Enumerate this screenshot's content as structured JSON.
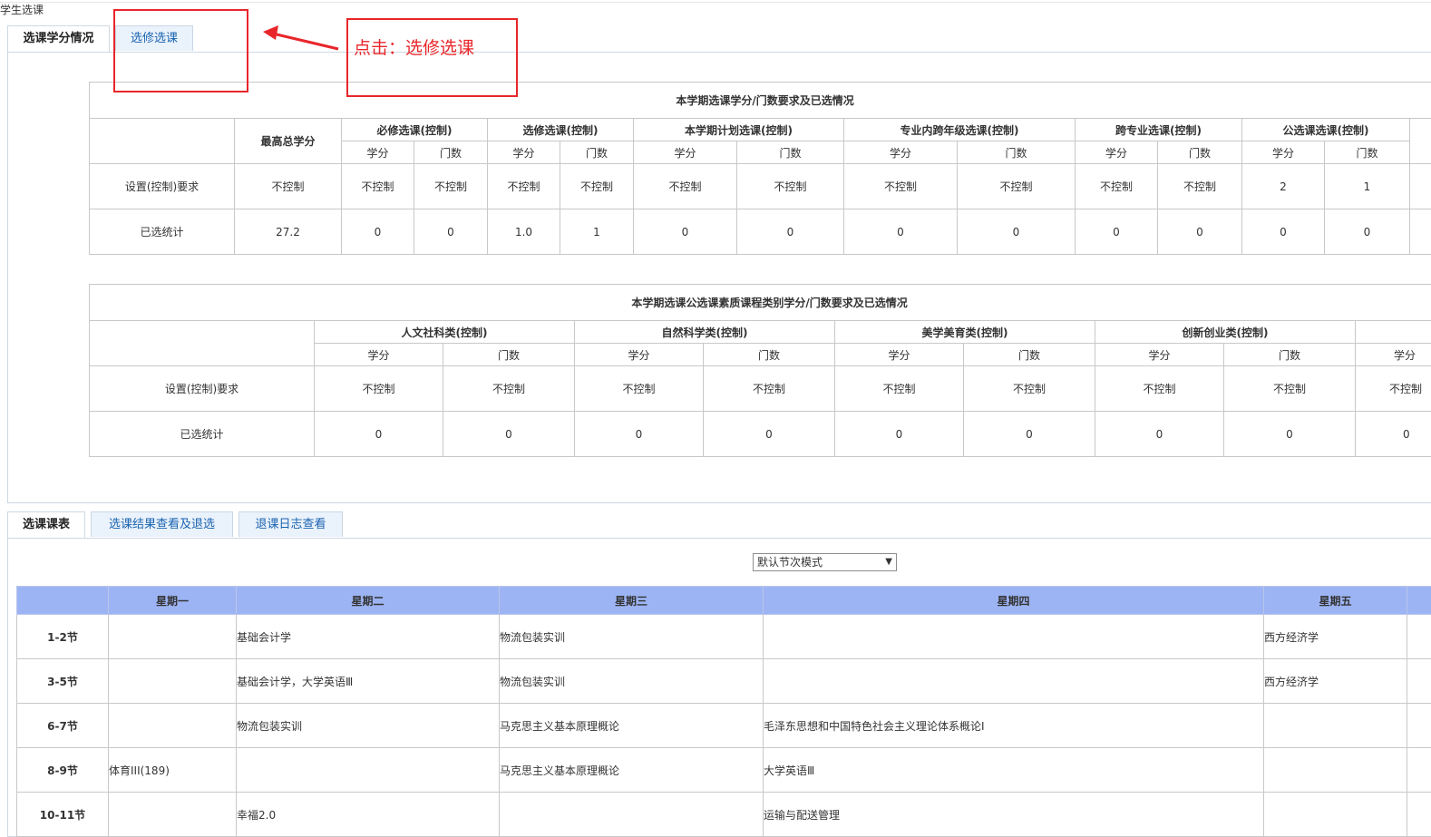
{
  "page": {
    "title": "学生选课"
  },
  "top_tabs": [
    {
      "label": "选课学分情况",
      "active": true
    },
    {
      "label": "选修选课",
      "active": false
    }
  ],
  "annotation": {
    "text": "点击：选修选课",
    "color": "#e8262a"
  },
  "credits_table": {
    "caption": "本学期选课学分/门数要求及已选情况",
    "max_credit_label": "最高总学分",
    "groups": [
      "必修选课(控制)",
      "选修选课(控制)",
      "本学期计划选课(控制)",
      "专业内跨年级选课(控制)",
      "跨专业选课(控制)",
      "公选课选课(控制)"
    ],
    "sub_headers": [
      "学分",
      "门数"
    ],
    "rows": [
      {
        "label": "设置(控制)要求",
        "max": "不控制",
        "cells": [
          "不控制",
          "不控制",
          "不控制",
          "不控制",
          "不控制",
          "不控制",
          "不控制",
          "不控制",
          "不控制",
          "不控制",
          "2",
          "1"
        ]
      },
      {
        "label": "已选统计",
        "max": "27.2",
        "cells": [
          "0",
          "0",
          "1.0",
          "1",
          "0",
          "0",
          "0",
          "0",
          "0",
          "0",
          "0",
          "0"
        ]
      }
    ]
  },
  "quality_table": {
    "caption": "本学期选课公选课素质课程类别学分/门数要求及已选情况",
    "groups": [
      "人文社科类(控制)",
      "自然科学类(控制)",
      "美学美育类(控制)",
      "创新创业类(控制)"
    ],
    "sub_headers": [
      "学分",
      "门数"
    ],
    "extra_sub": "学分",
    "rows": [
      {
        "label": "设置(控制)要求",
        "cells": [
          "不控制",
          "不控制",
          "不控制",
          "不控制",
          "不控制",
          "不控制",
          "不控制",
          "不控制"
        ],
        "extra": "不控制"
      },
      {
        "label": "已选统计",
        "cells": [
          "0",
          "0",
          "0",
          "0",
          "0",
          "0",
          "0",
          "0"
        ],
        "extra": "0"
      }
    ]
  },
  "bottom_tabs": [
    {
      "label": "选课课表",
      "active": true
    },
    {
      "label": "选课结果查看及退选",
      "active": false
    },
    {
      "label": "退课日志查看",
      "active": false
    }
  ],
  "mode_select": {
    "value": "默认节次模式"
  },
  "schedule": {
    "days": [
      "星期一",
      "星期二",
      "星期三",
      "星期四",
      "星期五"
    ],
    "rows": [
      {
        "period": "1-2节",
        "cells": [
          "",
          "基础会计学",
          "物流包装实训",
          "",
          "西方经济学"
        ]
      },
      {
        "period": "3-5节",
        "cells": [
          "",
          "基础会计学，大学英语Ⅲ",
          "物流包装实训",
          "",
          "西方经济学"
        ]
      },
      {
        "period": "6-7节",
        "cells": [
          "",
          "物流包装实训",
          "马克思主义基本原理概论",
          "毛泽东思想和中国特色社会主义理论体系概论Ⅰ",
          ""
        ]
      },
      {
        "period": "8-9节",
        "cells": [
          "体育III(189)",
          "",
          "马克思主义基本原理概论",
          "大学英语Ⅲ",
          ""
        ]
      },
      {
        "period": "10-11节",
        "cells": [
          "",
          "幸福2.0",
          "",
          "运输与配送管理",
          ""
        ]
      }
    ]
  }
}
